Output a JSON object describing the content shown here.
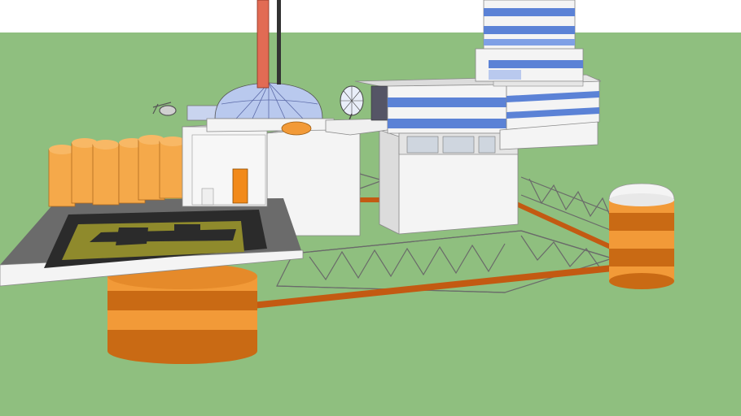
{
  "colors": {
    "sky": "#ffffff",
    "ground": "#8fbf7f",
    "orange": "#f29a38",
    "orange_dark": "#c96a14",
    "pipe": "#c35a12",
    "white_face": "#f4f4f4",
    "white_side": "#dcdcdc",
    "blue_band": "#5b82d6",
    "glass": "#b9c9ee",
    "deck_grey": "#6b6b6b",
    "helipad_dark": "#2b2b2b",
    "helipad_olive": "#8f8a2c",
    "truss": "#5b5b5b",
    "door": "#f28a1a"
  },
  "icons": {
    "satellite": "satellite-dish-icon",
    "helicopter": "helicopter-icon"
  }
}
